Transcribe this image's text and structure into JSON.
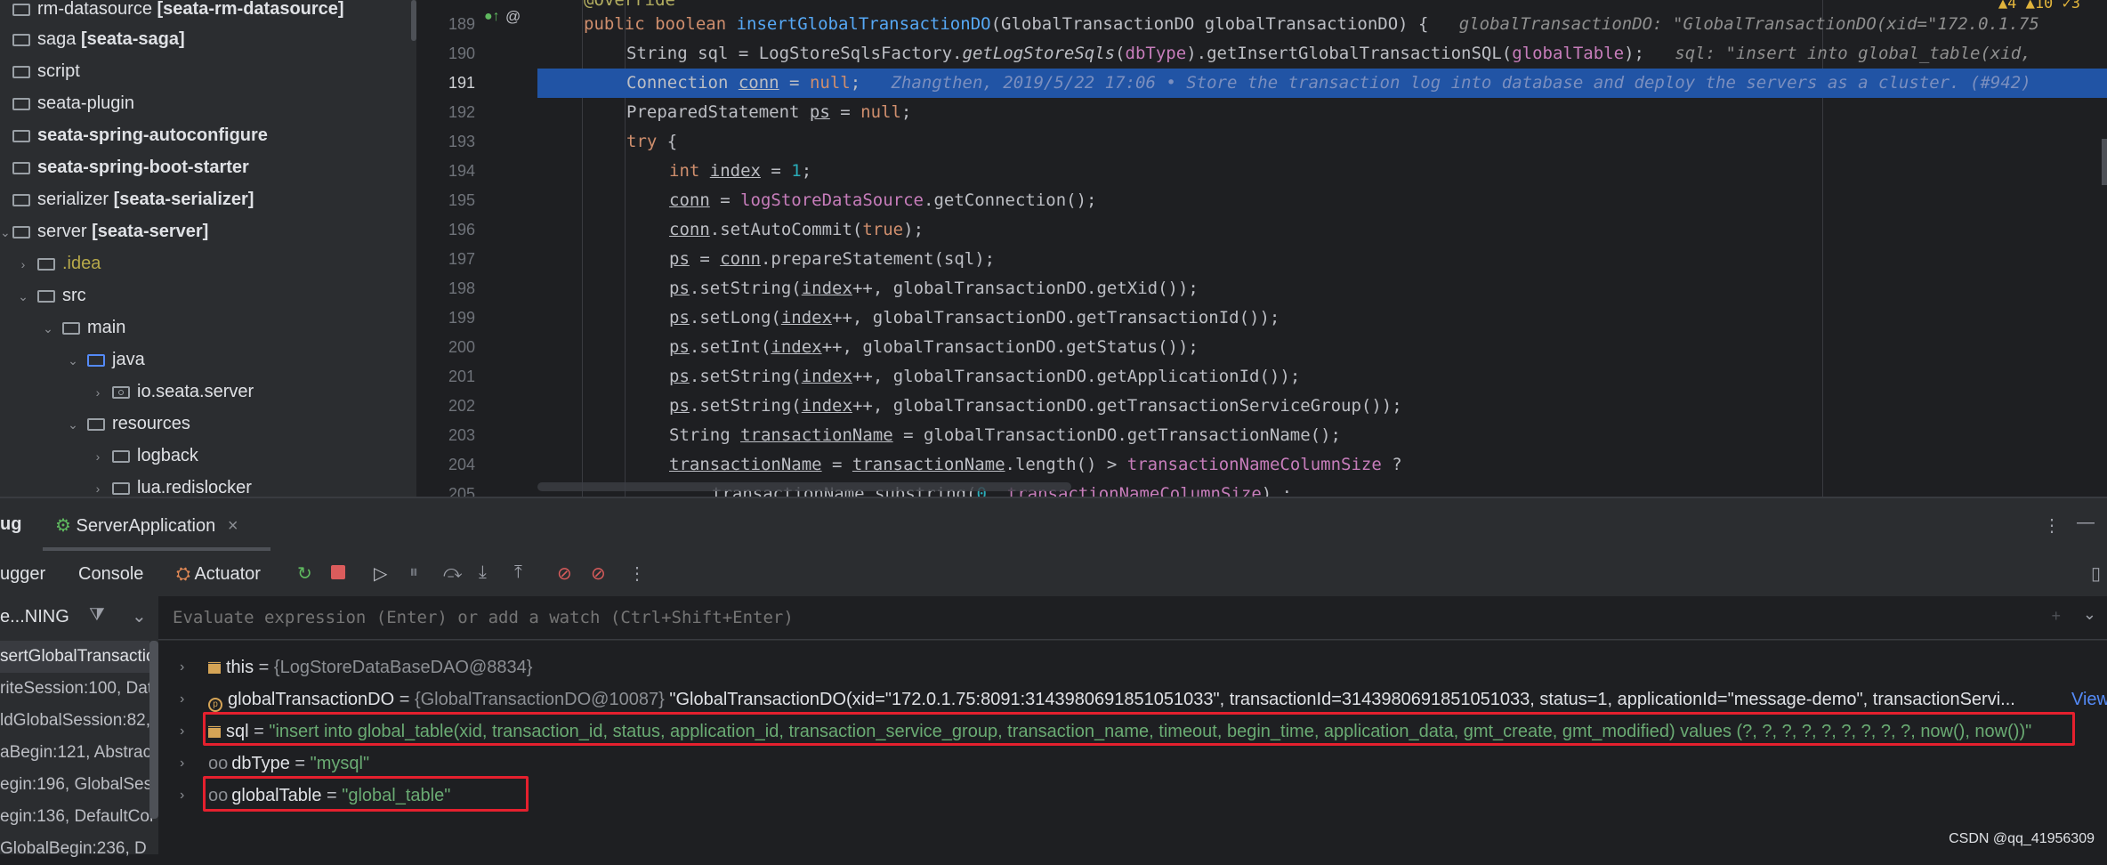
{
  "tree": {
    "items": [
      {
        "label": "rm-datasource",
        "module": "[seata-rm-datasource]"
      },
      {
        "label": "saga",
        "module": "[seata-saga]"
      },
      {
        "label": "script",
        "module": ""
      },
      {
        "label": "seata-plugin",
        "module": ""
      },
      {
        "label": "seata-spring-autoconfigure",
        "module": ""
      },
      {
        "label": "seata-spring-boot-starter",
        "module": ""
      },
      {
        "label": "serializer",
        "module": "[seata-serializer]"
      },
      {
        "label": "server",
        "module": "[seata-server]"
      },
      {
        "label": ".idea",
        "module": ""
      },
      {
        "label": "src",
        "module": ""
      },
      {
        "label": "main",
        "module": ""
      },
      {
        "label": "java",
        "module": ""
      },
      {
        "label": "io.seata.server",
        "module": ""
      },
      {
        "label": "resources",
        "module": ""
      },
      {
        "label": "logback",
        "module": ""
      },
      {
        "label": "lua.redislocker",
        "module": ""
      }
    ]
  },
  "editor": {
    "lines": [
      "189",
      "190",
      "191",
      "192",
      "193",
      "194",
      "195",
      "196",
      "197",
      "198",
      "199",
      "200",
      "201",
      "202",
      "203",
      "204",
      "205"
    ],
    "inlay_globalTransactionDO": "globalTransactionDO: \"GlobalTransactionDO(xid=\"172.0.1.75",
    "inlay_sql": "sql: \"insert into global_table(xid,",
    "blame": "Zhangthen, 2019/5/22 17:06 • Store the transaction log into database and deploy the servers as a cluster. (#942)",
    "warnings": "▲4 ▲10 ✓3"
  },
  "debug": {
    "tab_debug": "ug",
    "session": "ServerApplication",
    "tabs": [
      "ugger",
      "Console",
      "Actuator"
    ],
    "thread": "e...NING",
    "eval_placeholder": "Evaluate expression (Enter) or add a watch (Ctrl+Shift+Enter)",
    "frames": [
      "sertGlobalTransactio",
      "riteSession:100, Data",
      "ldGlobalSession:82,",
      "aBegin:121, Abstract",
      "egin:196, GlobalSess",
      "egin:136, DefaultCor",
      "GlobalBegin:236, D"
    ],
    "vars": {
      "this_name": "this",
      "this_value": "{LogStoreDataBaseDAO@8834}",
      "gtd_name": "globalTransactionDO",
      "gtd_type": "{GlobalTransactionDO@10087}",
      "gtd_value": "\"GlobalTransactionDO(xid=\"172.0.1.75:8091:3143980691851051033\", transactionId=3143980691851051033, status=1, applicationId=\"message-demo\", transactionServi...",
      "gtd_view": "View",
      "sql_name": "sql",
      "sql_value": "\"insert into global_table(xid, transaction_id, status, application_id, transaction_service_group, transaction_name, timeout, begin_time, application_data, gmt_create, gmt_modified) values (?, ?, ?, ?, ?, ?, ?, ?, ?, now(), now())\"",
      "dbtype_name": "dbType",
      "dbtype_value": "\"mysql\"",
      "gt_name": "globalTable",
      "gt_value": "\"global_table\""
    }
  },
  "watermark": "CSDN @qq_41956309"
}
